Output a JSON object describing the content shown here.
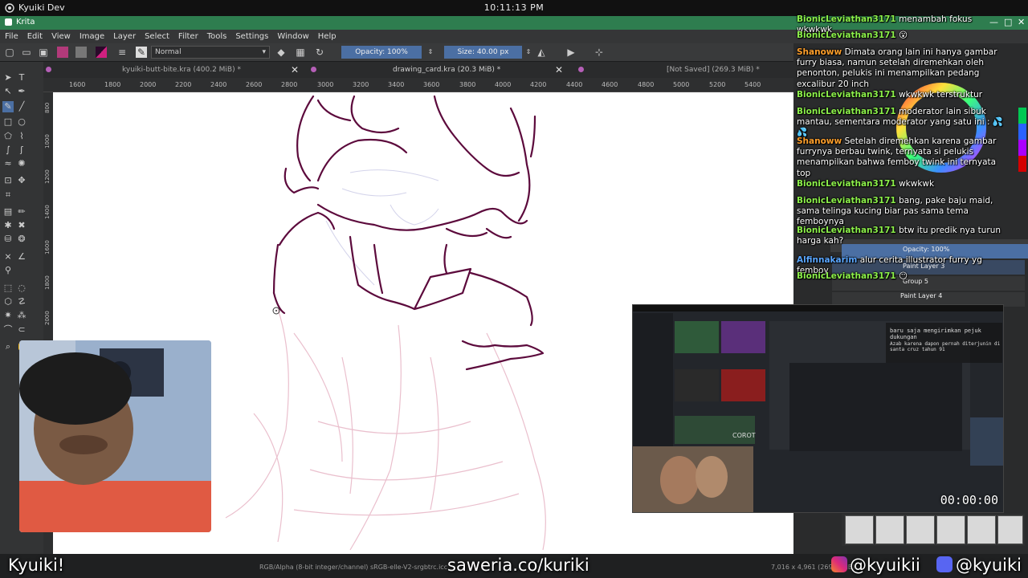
{
  "os": {
    "app_label": "Kyuiki Dev",
    "clock": "10:11:13 PM"
  },
  "window": {
    "title": "Krita",
    "minimize": "—",
    "maximize": "□",
    "close": "✕"
  },
  "menu": [
    "File",
    "Edit",
    "View",
    "Image",
    "Layer",
    "Select",
    "Filter",
    "Tools",
    "Settings",
    "Window",
    "Help"
  ],
  "toolbar": {
    "blend_mode": "Normal",
    "opacity": "Opacity: 100%",
    "size": "Size: 40.00 px"
  },
  "tabs": [
    {
      "label": "kyuiki-butt-bite.kra (400.2 MiB) *",
      "closable": true
    },
    {
      "label": "drawing_card.kra (20.3 MiB) *",
      "closable": true
    },
    {
      "label": "[Not Saved]  (269.3 MiB) *",
      "closable": false
    }
  ],
  "ruler": {
    "top": [
      "1600",
      "1800",
      "2000",
      "2200",
      "2400",
      "2600",
      "2800",
      "3000",
      "3200",
      "3400",
      "3600",
      "3800",
      "4000",
      "4200",
      "4400",
      "4600",
      "4800",
      "5000",
      "5200",
      "5400"
    ],
    "left": [
      "800",
      "1000",
      "1200",
      "1400",
      "1600",
      "1800",
      "2000"
    ]
  },
  "chat": [
    {
      "user": "BionicLeviathan3171",
      "color": "#8cf04a",
      "text": "menambah fokus wkwkwk"
    },
    {
      "user": "BionicLeviathan3171",
      "color": "#8cf04a",
      "text": "😮"
    },
    {
      "user": "Shanoww",
      "color": "#ff9f2b",
      "text": "Dimata orang lain ini hanya gambar furry biasa, namun setelah diremehkan oleh penonton, pelukis ini menampilkan pedang excalibur 20 inch"
    },
    {
      "user": "BionicLeviathan3171",
      "color": "#8cf04a",
      "text": "wkwkwk terstruktur"
    },
    {
      "user": "BionicLeviathan3171",
      "color": "#8cf04a",
      "text": "moderator lain sibuk mantau, sementara moderator yang satu ini : 💦💦"
    },
    {
      "user": "Shanoww",
      "color": "#ff9f2b",
      "text": "Setelah diremehkan karena gambar furrynya berbau twink, ternyata si pelukis menampilkan bahwa femboy twink ini ternyata top"
    },
    {
      "user": "BionicLeviathan3171",
      "color": "#8cf04a",
      "text": "wkwkwk"
    },
    {
      "user": "BionicLeviathan3171",
      "color": "#8cf04a",
      "text": "bang, pake baju maid, sama telinga kucing biar pas sama tema femboynya"
    },
    {
      "user": "BionicLeviathan3171",
      "color": "#8cf04a",
      "text": "btw itu predik nya turun harga kah?"
    },
    {
      "user": "Alfinnakarim",
      "color": "#5aa6ff",
      "text": "alur cerita illustrator furry yg femboy"
    },
    {
      "user": "BionicLeviathan3171",
      "color": "#8cf04a",
      "text": "😶"
    }
  ],
  "layers_docker": {
    "opacity": "Opacity: 100%",
    "layers": [
      "Paint Layer 3",
      "Group 5",
      "Paint Layer 4"
    ]
  },
  "embed": {
    "timer": "00:00:00",
    "game_label": "COROT",
    "chat_line_1": "baru saja mengirimkan pejuk dukungan",
    "chat_line_2": "Azab karena dapon pernah diterjunin di santa cruz tahun 91"
  },
  "status": {
    "color_info": "RGB/Alpha (8-bit integer/channel)  sRGB-elle-V2-srgbtrc.icc",
    "dims": "7,016 x 4,961 (269.3 MiB)"
  },
  "overlay": {
    "name": "Kyuiki!",
    "saweria": "saweria.co/kuriki",
    "instagram": "@kyuikii",
    "discord": "@kyuiki"
  },
  "colors": {
    "krita_title": "#2e7d4f",
    "sketch_line": "#5c0a3c",
    "sketch_light": "#e8b9c8",
    "chat_green": "#8cf04a",
    "chat_orange": "#ff9f2b",
    "chat_blue": "#5aa6ff"
  }
}
